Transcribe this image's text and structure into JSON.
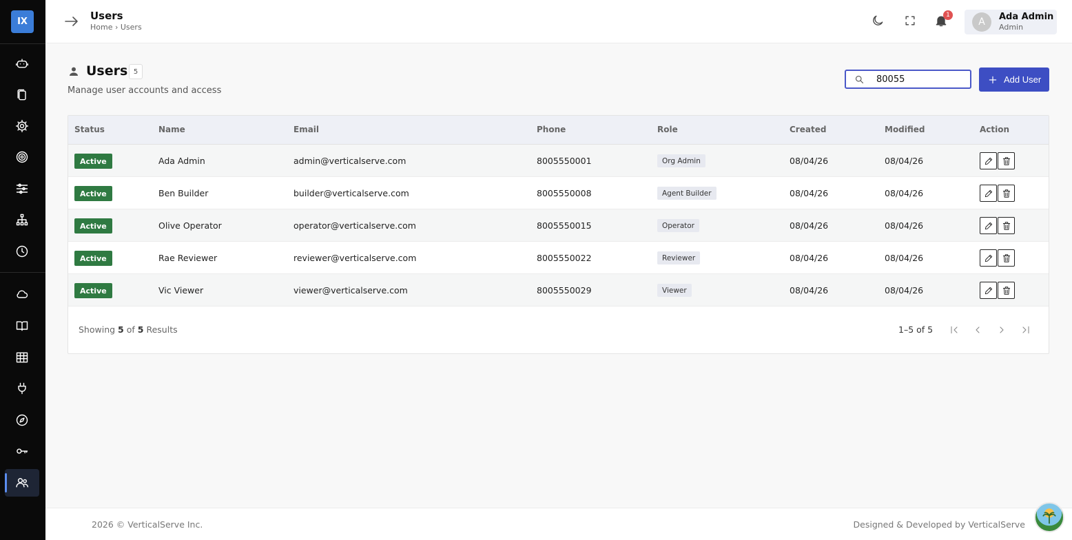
{
  "app": {
    "logo_text": "IX"
  },
  "header": {
    "title": "Users",
    "breadcrumb": "Home › Users",
    "notification_count": "1",
    "user": {
      "avatar_letter": "A",
      "name": "Ada Admin",
      "role": "Admin"
    }
  },
  "page": {
    "title": "Users",
    "count": "5",
    "subtitle": "Manage user accounts and access",
    "search_value": "80055",
    "add_button_label": "Add User"
  },
  "table": {
    "columns": [
      "Status",
      "Name",
      "Email",
      "Phone",
      "Role",
      "Created",
      "Modified",
      "Action"
    ],
    "rows": [
      {
        "status": "Active",
        "name": "Ada Admin",
        "email": "admin@verticalserve.com",
        "phone": "8005550001",
        "role": "Org Admin",
        "created": "08/04/26",
        "modified": "08/04/26"
      },
      {
        "status": "Active",
        "name": "Ben Builder",
        "email": "builder@verticalserve.com",
        "phone": "8005550008",
        "role": "Agent Builder",
        "created": "08/04/26",
        "modified": "08/04/26"
      },
      {
        "status": "Active",
        "name": "Olive Operator",
        "email": "operator@verticalserve.com",
        "phone": "8005550015",
        "role": "Operator",
        "created": "08/04/26",
        "modified": "08/04/26"
      },
      {
        "status": "Active",
        "name": "Rae Reviewer",
        "email": "reviewer@verticalserve.com",
        "phone": "8005550022",
        "role": "Reviewer",
        "created": "08/04/26",
        "modified": "08/04/26"
      },
      {
        "status": "Active",
        "name": "Vic Viewer",
        "email": "viewer@verticalserve.com",
        "phone": "8005550029",
        "role": "Viewer",
        "created": "08/04/26",
        "modified": "08/04/26"
      }
    ]
  },
  "pagination": {
    "showing_prefix": "Showing",
    "showing_from": "5",
    "showing_of": "of",
    "showing_total": "5",
    "showing_suffix": "Results",
    "range": "1–5 of 5"
  },
  "footer": {
    "left": "2026 © VerticalServe Inc.",
    "right": "Designed & Developed by VerticalServe"
  },
  "colors": {
    "accent": "#3d4ec3",
    "status_active": "#2f7a42",
    "sidebar_bg": "#0a0a0a",
    "logo_bg": "#3b7dd8",
    "badge": "#e05252"
  },
  "icons": {
    "sidebar": [
      "robot-icon",
      "documents-icon",
      "gear-icon",
      "target-icon",
      "sliders-icon",
      "hierarchy-icon",
      "history-icon",
      "cloud-icon",
      "book-icon",
      "table-icon",
      "plug-icon",
      "compass-icon",
      "key-icon",
      "users-icon"
    ],
    "header": [
      "arrow-right-icon",
      "moon-icon",
      "fullscreen-icon",
      "bell-icon"
    ]
  }
}
